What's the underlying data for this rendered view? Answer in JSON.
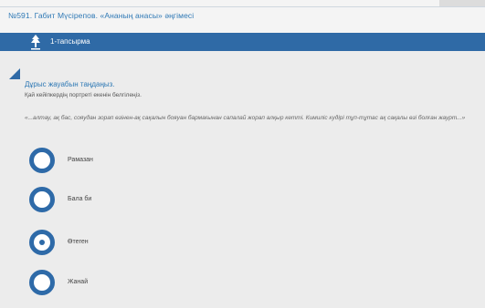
{
  "header": {
    "breadcrumb": "№591. Габит Мүсірепов. «Ананың анасы» әңгімесі"
  },
  "tab": {
    "label": "1-тапсырма",
    "icon": "tree-icon"
  },
  "task": {
    "instruction": "Дұрыс жауабын таңдаңыз.",
    "question": "Қай кейіпкердің портреті екенін белгілеңіз.",
    "quote": "«...алтау, ақ бас, сояудан зорап өзінен-ақ сақалын бояуан бармағынан сапалай жорап алқыр кетті. Кимиліс кудірі тұп-тұтас ақ сақалы өзі болған жаурт...»"
  },
  "options": [
    {
      "label": "Рамазан",
      "selected": false
    },
    {
      "label": "Бала би",
      "selected": false
    },
    {
      "label": "Өтеген",
      "selected": true
    },
    {
      "label": "Жанай",
      "selected": false
    }
  ],
  "colors": {
    "accent": "#2f6aa6",
    "link": "#2f79b5",
    "background": "#ececec"
  }
}
